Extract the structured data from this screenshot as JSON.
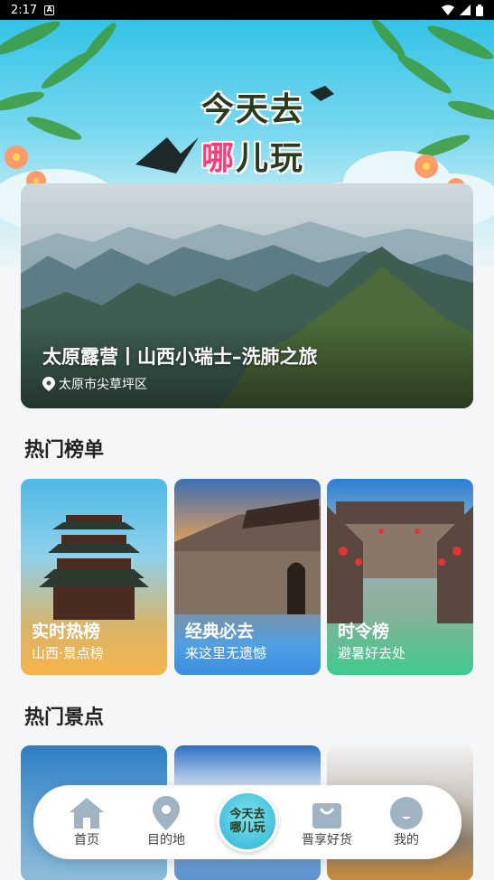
{
  "status_bar": {
    "time": "2:17"
  },
  "hero": {
    "line1": "今天去",
    "line2_highlight": "哪",
    "line2_rest": "儿玩"
  },
  "featured": {
    "title": "太原露营丨山西小瑞士–洗肺之旅",
    "location": "太原市尖草坪区"
  },
  "sections": {
    "hot_list": "热门榜单",
    "hot_spots": "热门景点"
  },
  "rank_cards": [
    {
      "label": "实时热榜",
      "sub": "山西·景点榜"
    },
    {
      "label": "经典必去",
      "sub": "来这里无遗憾"
    },
    {
      "label": "时令榜",
      "sub": "避暑好去处"
    }
  ],
  "nav": {
    "items": [
      {
        "label": "首页"
      },
      {
        "label": "目的地"
      },
      {
        "label": "晋享好货"
      },
      {
        "label": "我的"
      }
    ],
    "center_line1": "今天去",
    "center_line2": "哪儿玩"
  }
}
